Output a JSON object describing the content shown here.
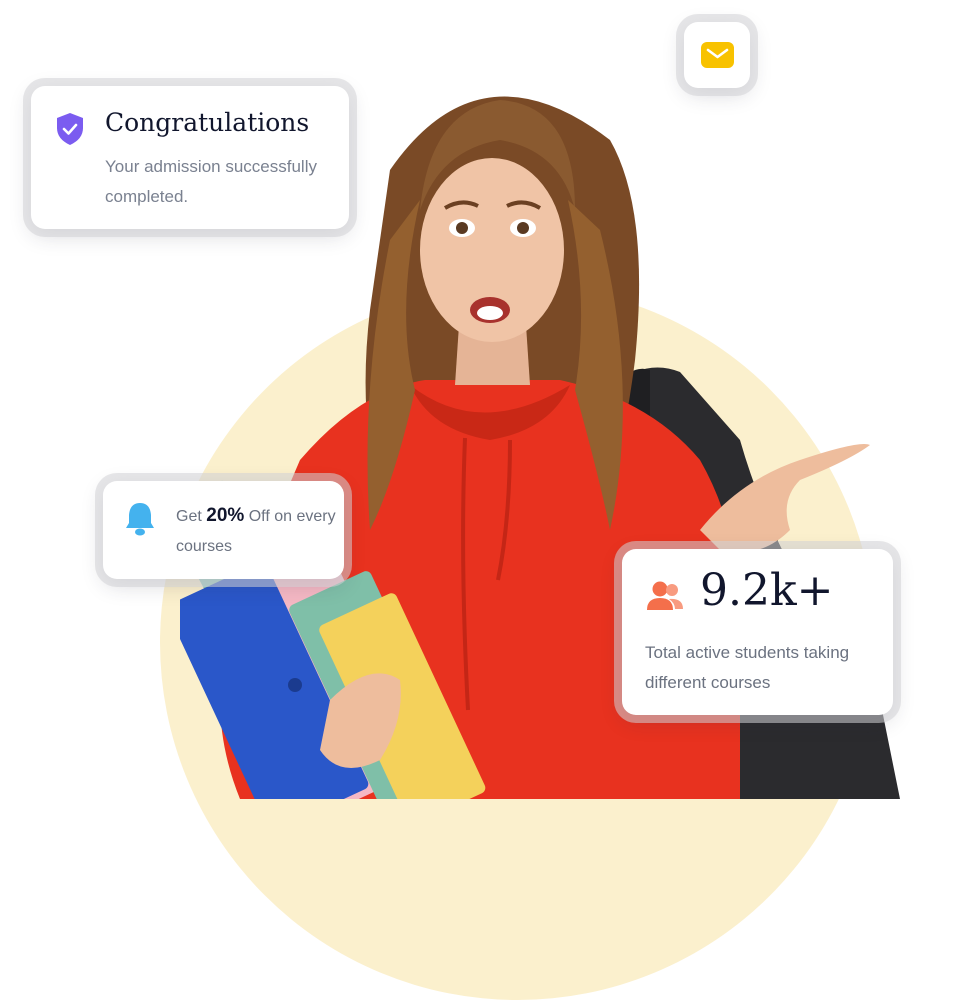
{
  "colors": {
    "circle": "#fbf0cd",
    "hoodie": "#e8321f",
    "shield": "#7b5cf0",
    "mail": "#f8c200",
    "bell": "#44b2ee",
    "users": "#f46f4b",
    "heading": "#11162d",
    "muted": "#7a8190"
  },
  "icons": {
    "shield": "shield-check-icon",
    "mail": "mail-icon",
    "bell": "bell-icon",
    "users": "users-icon"
  },
  "congrats_card": {
    "title": "Congratulations",
    "description": "Your admission successfully completed."
  },
  "offer_card": {
    "prefix": "Get",
    "highlight": "20%",
    "suffix": "Off on every courses"
  },
  "students_card": {
    "stat": "9.2k+",
    "description": "Total active students taking different courses"
  }
}
